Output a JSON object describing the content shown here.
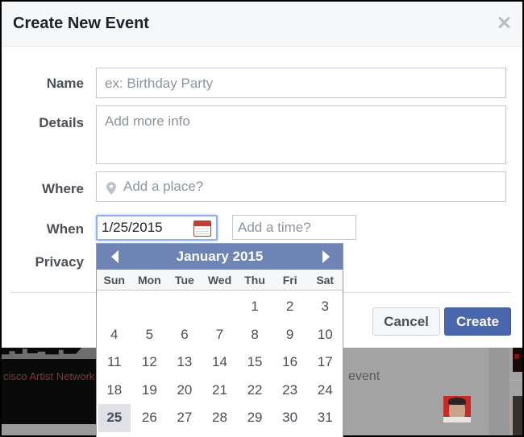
{
  "dialog": {
    "title": "Create New Event",
    "close_icon": "close-icon"
  },
  "form": {
    "name": {
      "label": "Name",
      "placeholder": "ex: Birthday Party",
      "value": ""
    },
    "details": {
      "label": "Details",
      "placeholder": "Add more info",
      "value": ""
    },
    "where": {
      "label": "Where",
      "placeholder": "Add a place?",
      "icon": "map-pin-icon",
      "value": ""
    },
    "when": {
      "label": "When",
      "date_value": "1/25/2015",
      "date_icon": "calendar-icon",
      "time_placeholder": "Add a time?"
    },
    "privacy": {
      "label": "Privacy"
    }
  },
  "buttons": {
    "cancel": "Cancel",
    "create": "Create"
  },
  "calendar": {
    "month_title": "January 2015",
    "prev_icon": "chevron-left-icon",
    "next_icon": "chevron-right-icon",
    "weekdays": [
      "Sun",
      "Mon",
      "Tue",
      "Wed",
      "Thu",
      "Fri",
      "Sat"
    ],
    "weeks": [
      [
        "",
        "",
        "",
        "",
        "1",
        "2",
        "3"
      ],
      [
        "4",
        "5",
        "6",
        "7",
        "8",
        "9",
        "10"
      ],
      [
        "11",
        "12",
        "13",
        "14",
        "15",
        "16",
        "17"
      ],
      [
        "18",
        "19",
        "20",
        "21",
        "22",
        "23",
        "24"
      ],
      [
        "25",
        "26",
        "27",
        "28",
        "29",
        "30",
        "31"
      ]
    ],
    "selected_day": "25"
  },
  "background": {
    "banner_text": "cisco Artist Network",
    "event_text": "event"
  },
  "colors": {
    "brand_blue": "#4a66ad",
    "calendar_header": "#6d84b4",
    "focus_border": "#8fb3ee"
  }
}
